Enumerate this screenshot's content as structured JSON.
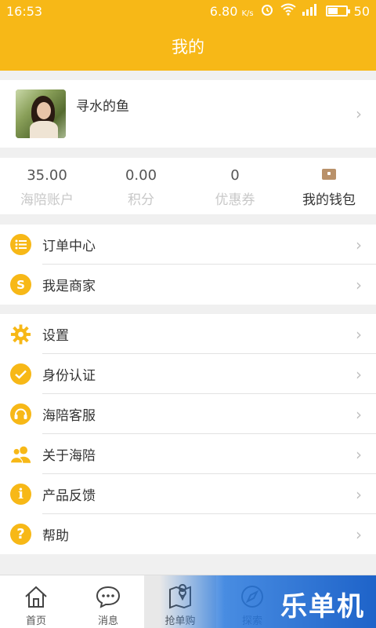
{
  "status_bar": {
    "time": "16:53",
    "speed": "6.80",
    "speed_unit": "K/s",
    "battery": "50",
    "battery_fraction": 0.5
  },
  "header": {
    "title": "我的"
  },
  "profile": {
    "name": "寻水的鱼"
  },
  "stats": [
    {
      "value": "35.00",
      "label": "海陪账户"
    },
    {
      "value": "0.00",
      "label": "积分"
    },
    {
      "value": "0",
      "label": "优惠券"
    },
    {
      "label": "我的钱包",
      "icon": "wallet-icon"
    }
  ],
  "menu_group_1": [
    {
      "label": "订单中心",
      "icon": "list-icon"
    },
    {
      "label": "我是商家",
      "icon": "merchant-icon"
    }
  ],
  "menu_group_2": [
    {
      "label": "设置",
      "icon": "gear-icon"
    },
    {
      "label": "身份认证",
      "icon": "check-icon"
    },
    {
      "label": "海陪客服",
      "icon": "headset-icon"
    },
    {
      "label": "关于海陪",
      "icon": "users-icon"
    },
    {
      "label": "产品反馈",
      "icon": "info-icon"
    },
    {
      "label": "帮助",
      "icon": "help-icon"
    }
  ],
  "tabs": [
    {
      "label": "首页",
      "icon": "home-icon"
    },
    {
      "label": "消息",
      "icon": "message-icon"
    },
    {
      "label": "抢单购",
      "icon": "map-pin-icon"
    },
    {
      "label": "探索",
      "icon": "compass-icon"
    }
  ],
  "watermark": "乐单机",
  "colors": {
    "accent": "#f7b817",
    "background": "#f0f0f0"
  }
}
